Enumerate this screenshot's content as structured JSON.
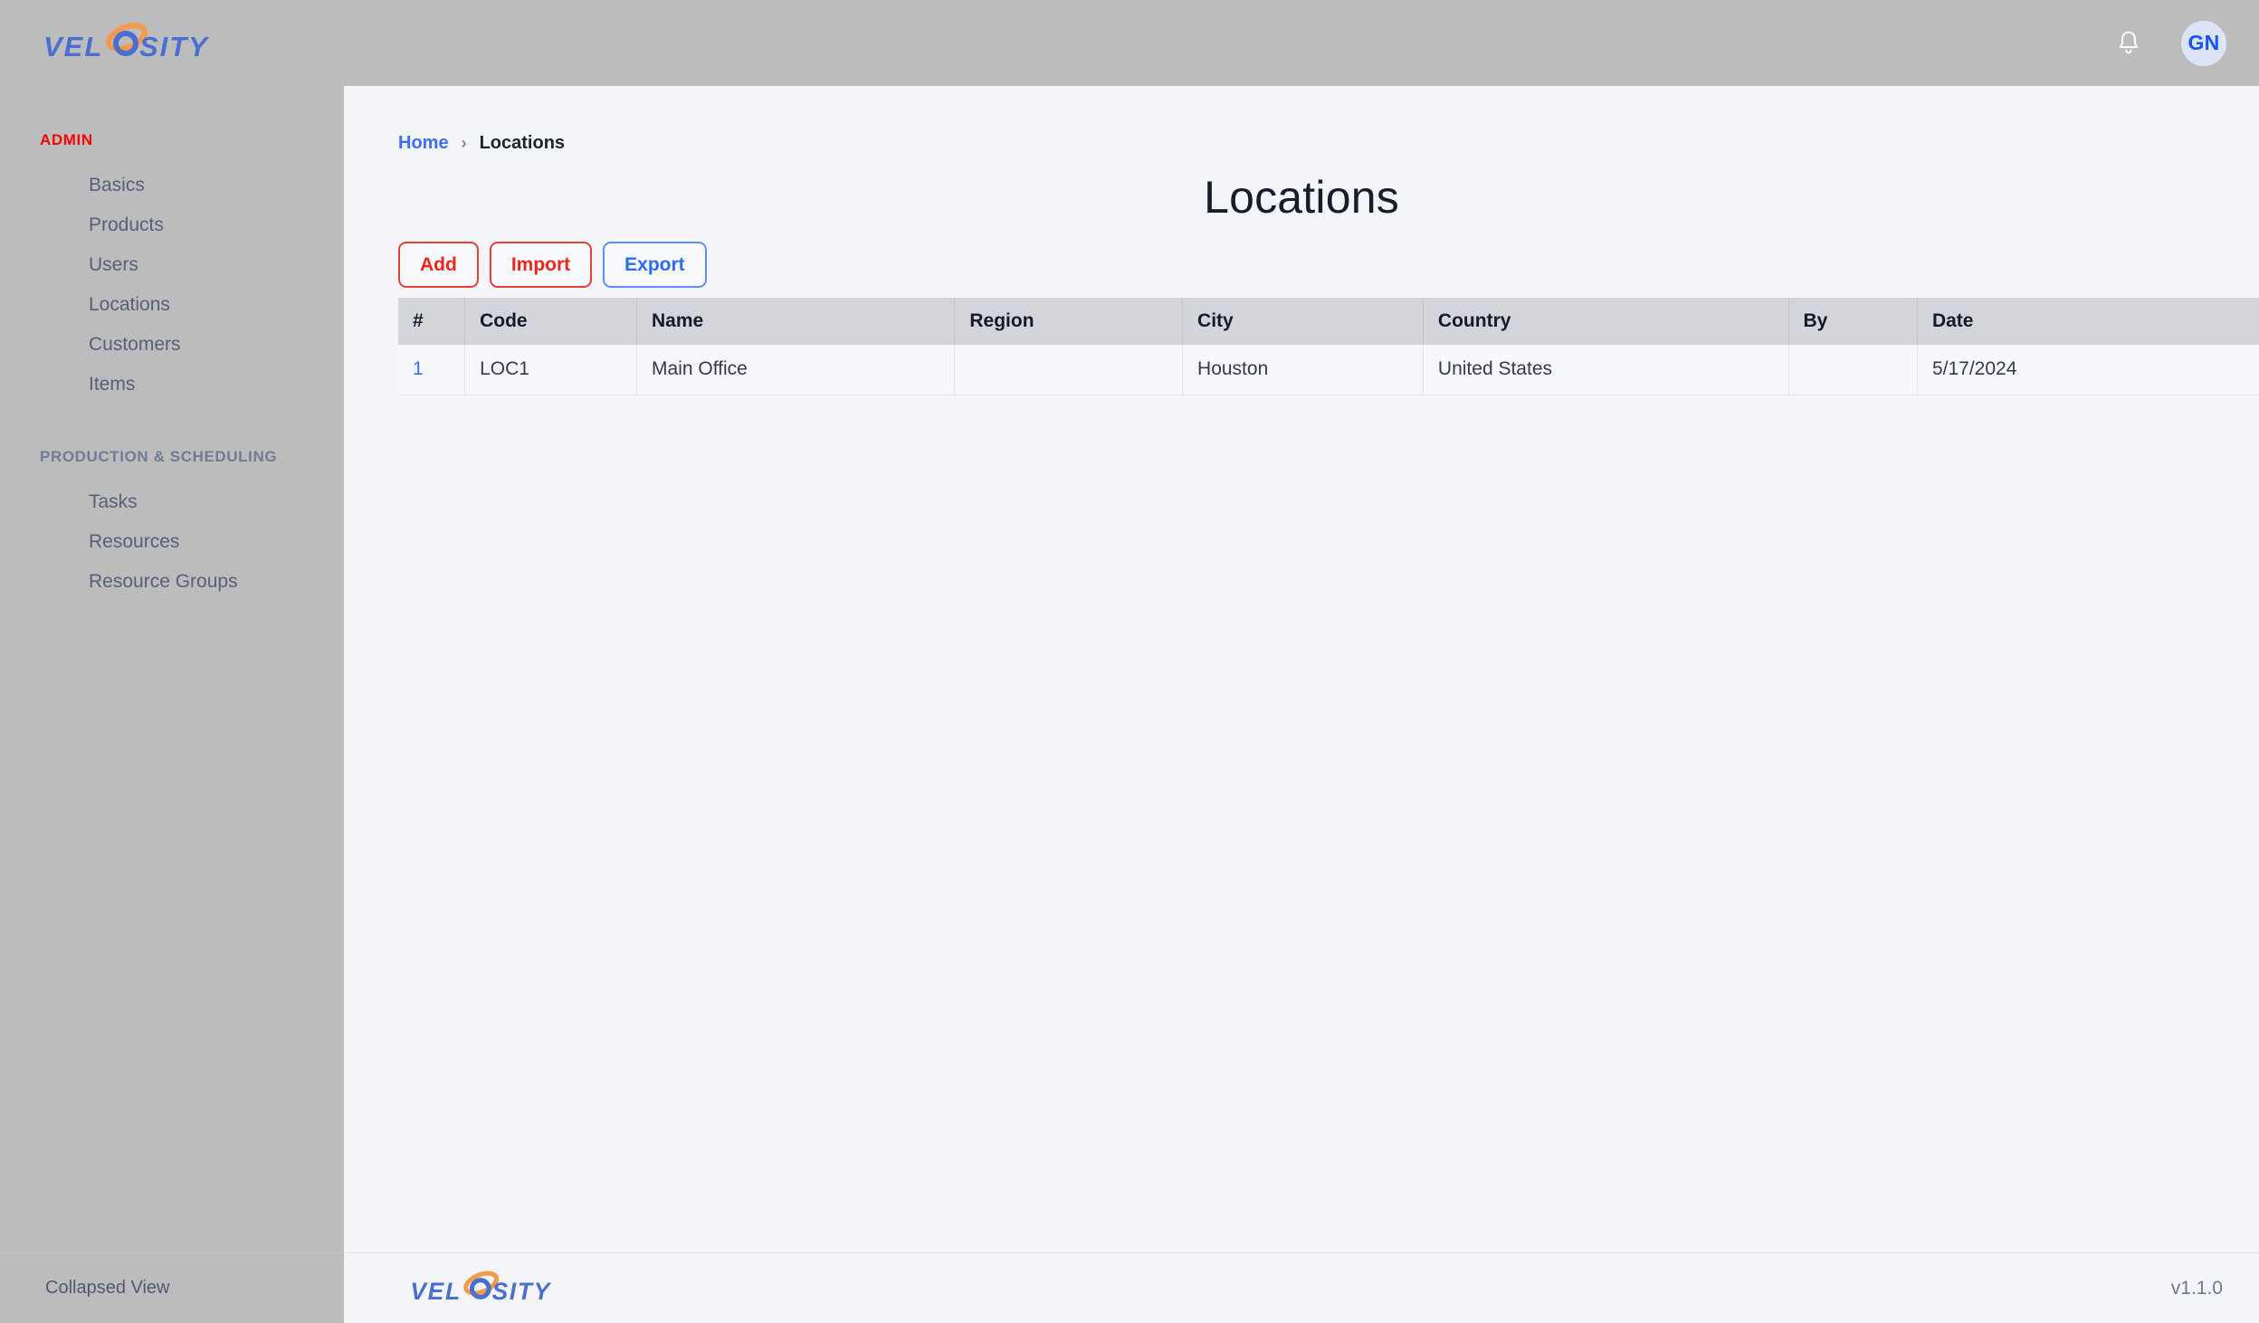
{
  "brand": {
    "name": "VELOSITY",
    "text_before": "VEL",
    "text_after": "SITY",
    "blue": "#4a6fd0",
    "orange": "#f59a4b"
  },
  "header": {
    "notifications_icon": "bell-icon",
    "avatar_initials": "GN"
  },
  "sidebar": {
    "sections": [
      {
        "title": "ADMIN",
        "color": "#f50505",
        "items": [
          {
            "label": "Basics"
          },
          {
            "label": "Products"
          },
          {
            "label": "Users"
          },
          {
            "label": "Locations"
          },
          {
            "label": "Customers"
          },
          {
            "label": "Items"
          }
        ]
      },
      {
        "title": "PRODUCTION & SCHEDULING",
        "color": "#707b96",
        "items": [
          {
            "label": "Tasks"
          },
          {
            "label": "Resources"
          },
          {
            "label": "Resource Groups"
          }
        ]
      }
    ],
    "footer": {
      "collapse_label": "Collapsed View"
    }
  },
  "breadcrumb": {
    "home": "Home",
    "separator": "›",
    "current": "Locations"
  },
  "page": {
    "title": "Locations"
  },
  "toolbar": {
    "add_label": "Add",
    "import_label": "Import",
    "export_label": "Export"
  },
  "table": {
    "columns": [
      {
        "key": "num",
        "label": "#"
      },
      {
        "key": "code",
        "label": "Code"
      },
      {
        "key": "name",
        "label": "Name"
      },
      {
        "key": "region",
        "label": "Region"
      },
      {
        "key": "city",
        "label": "City"
      },
      {
        "key": "country",
        "label": "Country"
      },
      {
        "key": "by",
        "label": "By"
      },
      {
        "key": "date",
        "label": "Date"
      }
    ],
    "rows": [
      {
        "num": "1",
        "code": "LOC1",
        "name": "Main Office",
        "region": "",
        "city": "Houston",
        "country": "United States",
        "by": "",
        "date": "5/17/2024"
      }
    ]
  },
  "footer": {
    "version": "v1.1.0"
  }
}
